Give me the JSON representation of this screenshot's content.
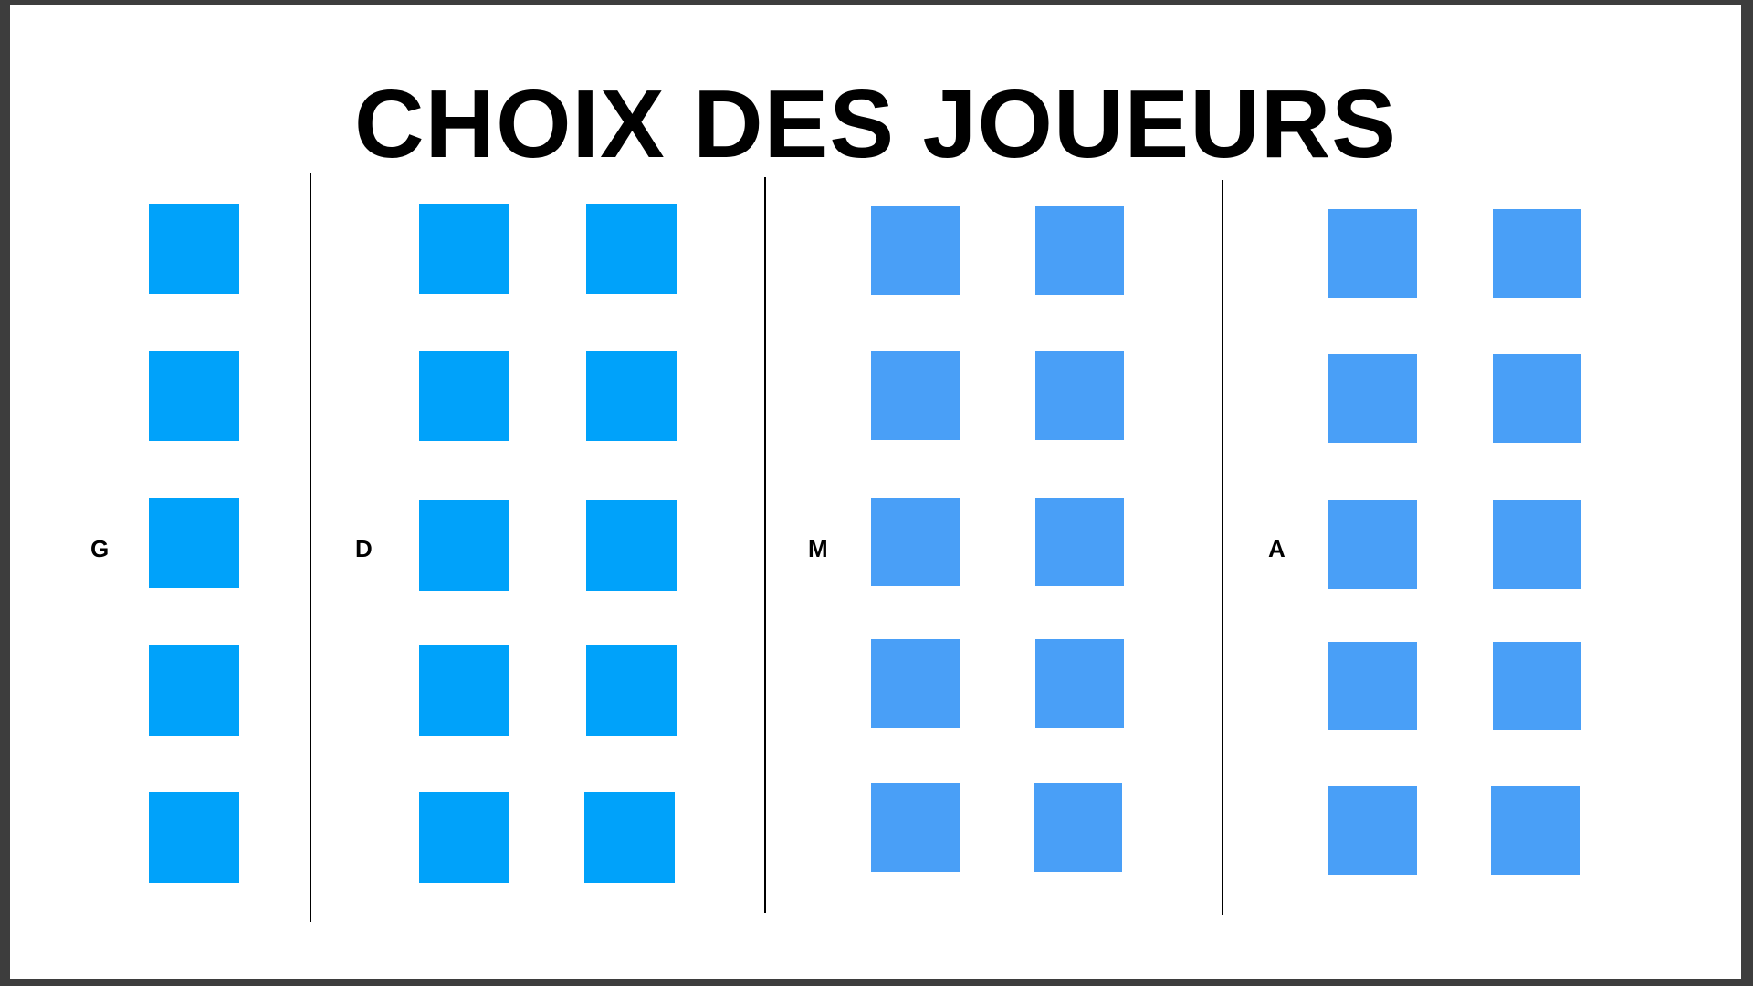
{
  "title": "CHOIX DES JOUEURS",
  "colors": {
    "background": "#ffffff",
    "frame": "#3d3d3d",
    "slot_defense": "#00a2fa",
    "slot_attack": "#499ff7",
    "divider": "#000000"
  },
  "columns": [
    {
      "label": "G",
      "slot_count": 5
    },
    {
      "label": "D",
      "slot_count": 10
    },
    {
      "label": "M",
      "slot_count": 10
    },
    {
      "label": "A",
      "slot_count": 10
    }
  ]
}
